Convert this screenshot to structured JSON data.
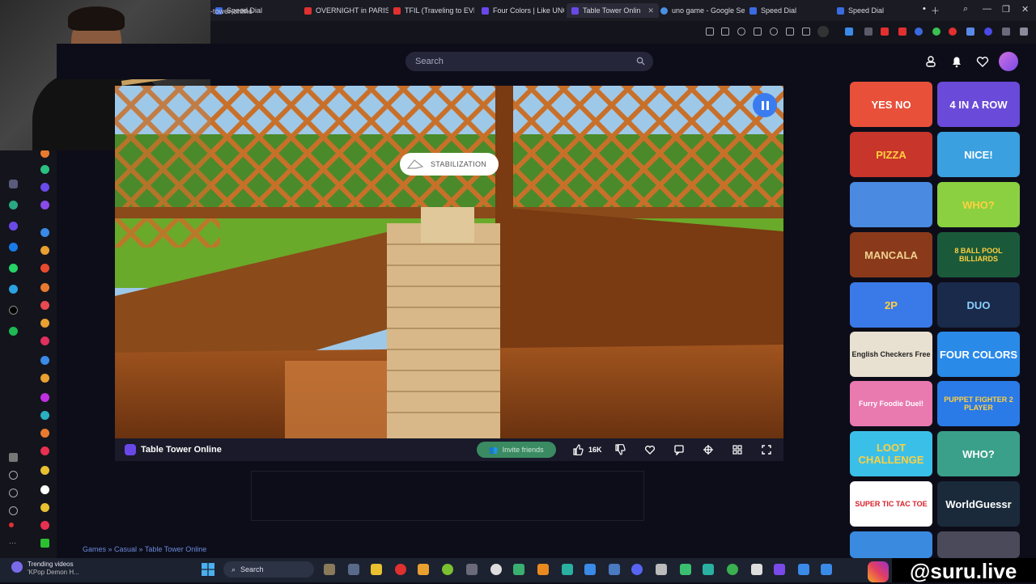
{
  "browser": {
    "tabs": [
      {
        "label": "Speed Dial",
        "fav": "#3a6be0"
      },
      {
        "label": "OVERNIGHT in PARIS CAT",
        "fav": "#e03030"
      },
      {
        "label": "TFIL (Traveling to EVERY",
        "fav": "#e03030"
      },
      {
        "label": "Four Colors | Like UNO C",
        "fav": "#6a48e8"
      },
      {
        "label": "Table Tower Onlin",
        "fav": "#6a48e8"
      },
      {
        "label": "uno game - Google Sear",
        "fav": "#4a90e2"
      },
      {
        "label": "Speed Dial",
        "fav": "#3a6be0"
      },
      {
        "label": "Speed Dial",
        "fav": "#3a6be0"
      }
    ],
    "url": "-tower-online"
  },
  "site": {
    "search_placeholder": "Search"
  },
  "game": {
    "title": "Table Tower Online",
    "overlay_label": "STABILIZATION",
    "invite_label": "Invite friends",
    "likes": "16K",
    "breadcrumb": "Games » Casual » Table Tower Online"
  },
  "tiles": [
    {
      "label": "YES NO",
      "bg": "#e8503a",
      "fg": "#fff"
    },
    {
      "label": "4 IN A ROW",
      "bg": "#6a4ad8",
      "fg": "#fff"
    },
    {
      "label": "PIZZA",
      "bg": "#c8352a",
      "fg": "#ffd040"
    },
    {
      "label": "NICE!",
      "bg": "#3aa0e0",
      "fg": "#fff"
    },
    {
      "label": "",
      "bg": "#4a8ae0",
      "fg": "#fff"
    },
    {
      "label": "WHO?",
      "bg": "#8ad040",
      "fg": "#ffd040"
    },
    {
      "label": "MANCALA",
      "bg": "#8a3a1a",
      "fg": "#f0d090"
    },
    {
      "label": "8 BALL POOL BILLIARDS",
      "bg": "#1a5a3a",
      "fg": "#ffd040"
    },
    {
      "label": "2P",
      "bg": "#3a7ae8",
      "fg": "#ffd040"
    },
    {
      "label": "DUO",
      "bg": "#1a2a4a",
      "fg": "#8ad0ff"
    },
    {
      "label": "English Checkers Free",
      "bg": "#e8e0d0",
      "fg": "#222"
    },
    {
      "label": "FOUR COLORS",
      "bg": "#2a8ae8",
      "fg": "#fff"
    },
    {
      "label": "Furry Foodie Duel!",
      "bg": "#e87ab0",
      "fg": "#fff"
    },
    {
      "label": "PUPPET FIGHTER 2 PLAYER",
      "bg": "#2a7ae8",
      "fg": "#ffd040"
    },
    {
      "label": "LOOT CHALLENGE",
      "bg": "#3ac0e8",
      "fg": "#ffd040"
    },
    {
      "label": "WHO?",
      "bg": "#3aa08a",
      "fg": "#fff"
    },
    {
      "label": "SUPER TIC TAC TOE",
      "bg": "#ffffff",
      "fg": "#d8202a"
    },
    {
      "label": "WorldGuessr",
      "bg": "#1a2a3a",
      "fg": "#fff"
    },
    {
      "label": "",
      "bg": "#3a8ae0",
      "fg": "#fff"
    },
    {
      "label": "",
      "bg": "#4a4a5a",
      "fg": "#fff"
    }
  ],
  "taskbar": {
    "trend_title": "Trending videos",
    "trend_sub": "'KPop Demon H...",
    "search_label": "Search",
    "handle": "@suru.live"
  }
}
